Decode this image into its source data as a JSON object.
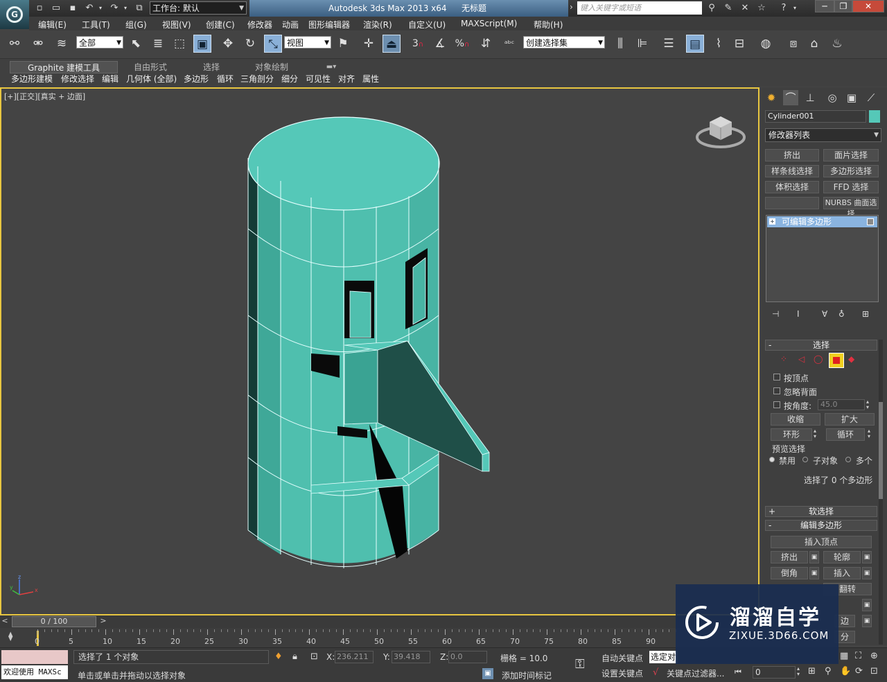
{
  "title": {
    "app": "Autodesk 3ds Max  2013 x64",
    "doc": "无标题",
    "workspace_label": "工作台: 默认",
    "search_placeholder": "键入关键字或短语"
  },
  "menu": [
    "编辑(E)",
    "工具(T)",
    "组(G)",
    "视图(V)",
    "创建(C)",
    "修改器",
    "动画",
    "图形编辑器",
    "渲染(R)",
    "自定义(U)",
    "MAXScript(M)",
    "帮助(H)"
  ],
  "toolbar": {
    "selection_filter": "全部",
    "ref_coord": "视图",
    "named_selection": "创建选择集",
    "snap_label": "3",
    "spinner_label": "%"
  },
  "ribbon": {
    "tabs": [
      "Graphite 建模工具",
      "自由形式",
      "选择",
      "对象绘制"
    ],
    "items": [
      "多边形建模",
      "修改选择",
      "编辑",
      "几何体 (全部)",
      "多边形",
      "循环",
      "三角剖分",
      "细分",
      "可见性",
      "对齐",
      "属性"
    ]
  },
  "viewport": {
    "label": "[+][正交][真实 + 边面]",
    "axis_x": "x",
    "axis_y": "y",
    "axis_z": "z",
    "object_color": "#55c8b8"
  },
  "panel": {
    "object_name": "Cylinder001",
    "modifier_list": "修改器列表",
    "mod_buttons": [
      "挤出",
      "面片选择",
      "样条线选择",
      "多边形选择",
      "体积选择",
      "FFD 选择",
      "",
      "NURBS 曲面选择"
    ],
    "stack_item": "可编辑多边形",
    "selection": {
      "header": "选择",
      "by_vertex": "按顶点",
      "ignore_backfacing": "忽略背面",
      "by_angle": "按角度:",
      "angle_value": "45.0",
      "shrink": "收缩",
      "grow": "扩大",
      "ring": "环形",
      "loop": "循环",
      "preview_group": "预览选择",
      "preview_off": "禁用",
      "preview_sub": "子对象",
      "preview_multi": "多个",
      "status": "选择了 0 个多边形"
    },
    "soft_selection": "软选择",
    "edit_poly": {
      "header": "编辑多边形",
      "insert_vertex": "插入顶点",
      "extrude": "挤出",
      "outline": "轮廓",
      "bevel": "倒角",
      "inset": "插入",
      "flip": "翻转",
      "partial_a": "分",
      "partial_b": "边"
    }
  },
  "timeline": {
    "frame_counter": "0 / 100",
    "ticks": [
      "0",
      "5",
      "10",
      "15",
      "20",
      "25",
      "30",
      "35",
      "40",
      "45",
      "50",
      "55",
      "60",
      "65",
      "70",
      "75",
      "80",
      "85",
      "90"
    ]
  },
  "status": {
    "welcome": "欢迎使用 MAXSc",
    "selected": "选择了 1 个对象",
    "prompt": "单击或单击并拖动以选择对象",
    "x_label": "X:",
    "x": "236.211",
    "y_label": "Y:",
    "y": "39.418",
    "z_label": "Z:",
    "z": "0.0",
    "grid": "栅格 = 10.0",
    "add_time_tag": "添加时间标记",
    "auto_key": "自动关键点",
    "set_key": "设置关键点",
    "selected_set": "选定对",
    "key_filters": "关键点过滤器...",
    "frame_field": "0"
  },
  "watermark": {
    "brand": "溜溜自学",
    "site": "ZIXUE.3D66.COM"
  }
}
